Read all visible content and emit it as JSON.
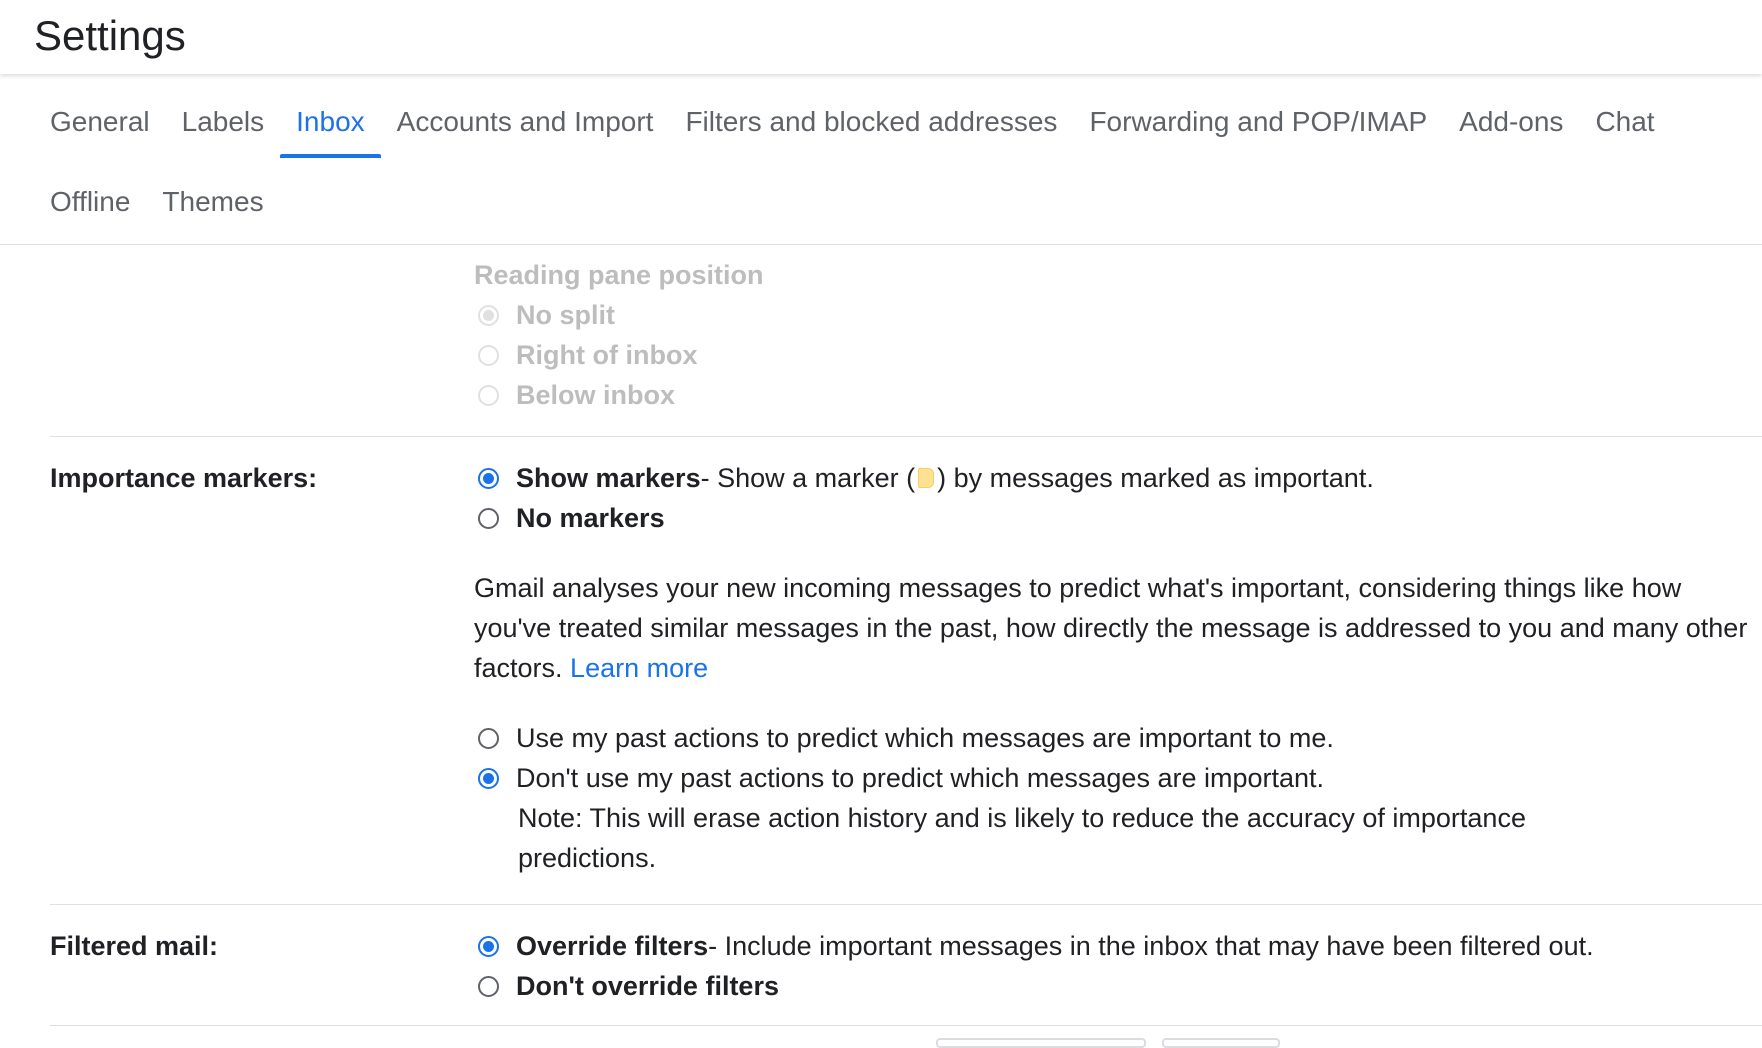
{
  "header": {
    "title": "Settings"
  },
  "tabs": {
    "row1": [
      {
        "label": "General",
        "active": false
      },
      {
        "label": "Labels",
        "active": false
      },
      {
        "label": "Inbox",
        "active": true
      },
      {
        "label": "Accounts and Import",
        "active": false
      },
      {
        "label": "Filters and blocked addresses",
        "active": false
      },
      {
        "label": "Forwarding and POP/IMAP",
        "active": false
      },
      {
        "label": "Add-ons",
        "active": false
      },
      {
        "label": "Chat",
        "active": false
      }
    ],
    "row2": [
      {
        "label": "Offline",
        "active": false
      },
      {
        "label": "Themes",
        "active": false
      }
    ]
  },
  "reading_pane": {
    "heading": "Reading pane position",
    "options": [
      "No split",
      "Right of inbox",
      "Below inbox"
    ],
    "selected": "No split",
    "disabled": true
  },
  "importance": {
    "label": "Importance markers:",
    "show_title": "Show markers",
    "show_desc_before": " - Show a marker (",
    "show_desc_after": ") by messages marked as important.",
    "no_markers": "No markers",
    "selected": "Show markers",
    "paragraph": "Gmail analyses your new incoming messages to predict what's important, considering things like how you've treated similar messages in the past, how directly the message is addressed to you and many other factors.",
    "learn_more": "Learn more",
    "use_past": "Use my past actions to predict which messages are important to me.",
    "dont_use_past": "Don't use my past actions to predict which messages are important.",
    "past_selected": "dont_use_past",
    "note": "Note: This will erase action history and is likely to reduce the accuracy of importance predictions.",
    "marker_color": "#fde293"
  },
  "filtered": {
    "label": "Filtered mail:",
    "override_title": "Override filters",
    "override_desc": " - Include important messages in the inbox that may have been filtered out.",
    "dont_override": "Don't override filters",
    "selected": "Override filters"
  },
  "colors": {
    "accent": "#1a73e8",
    "text": "#202124",
    "muted": "#5f6368",
    "disabled": "#bdbdbd"
  }
}
